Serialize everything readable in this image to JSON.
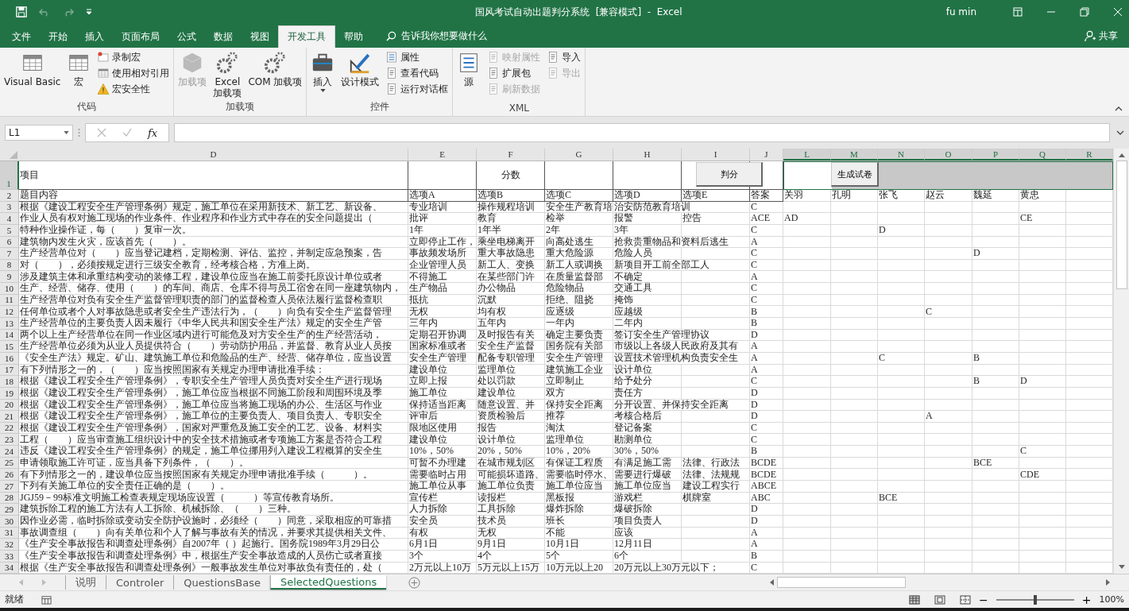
{
  "window": {
    "title": "国风考试自动出题判分系统  [兼容模式]  -  Excel",
    "user": "fu min"
  },
  "ribbon_tabs": [
    {
      "label": "文件",
      "selected": false
    },
    {
      "label": "开始",
      "selected": false
    },
    {
      "label": "插入",
      "selected": false
    },
    {
      "label": "页面布局",
      "selected": false
    },
    {
      "label": "公式",
      "selected": false
    },
    {
      "label": "数据",
      "selected": false
    },
    {
      "label": "视图",
      "selected": false
    },
    {
      "label": "开发工具",
      "selected": true
    },
    {
      "label": "帮助",
      "selected": false
    }
  ],
  "tell_me": {
    "placeholder": "告诉我你想要做什么"
  },
  "share": "共享",
  "ribbon_groups": [
    {
      "label": "代码",
      "items": [
        {
          "kind": "large",
          "label": "Visual Basic",
          "disabled": false
        },
        {
          "kind": "large",
          "label": "宏",
          "disabled": false
        },
        {
          "kind": "small",
          "label": "录制宏",
          "disabled": false
        },
        {
          "kind": "small",
          "label": "使用相对引用",
          "disabled": false
        },
        {
          "kind": "small",
          "label": "宏安全性",
          "disabled": false
        }
      ]
    },
    {
      "label": "加载项",
      "items": [
        {
          "kind": "narrow",
          "label": "加载项",
          "disabled": true
        },
        {
          "kind": "large",
          "label": "Excel\n加载项",
          "disabled": false
        },
        {
          "kind": "large",
          "label": "COM 加载项",
          "disabled": false
        }
      ]
    },
    {
      "label": "控件",
      "items": [
        {
          "kind": "menu",
          "label": "插入",
          "disabled": false
        },
        {
          "kind": "large",
          "label": "设计模式",
          "disabled": false
        },
        {
          "kind": "small",
          "label": "属性",
          "disabled": false
        },
        {
          "kind": "small",
          "label": "查看代码",
          "disabled": false
        },
        {
          "kind": "small",
          "label": "运行对话框",
          "disabled": false
        }
      ]
    },
    {
      "label": "XML",
      "items": [
        {
          "kind": "large",
          "label": "源",
          "disabled": false
        },
        {
          "kind": "small",
          "label": "映射属性",
          "disabled": true
        },
        {
          "kind": "small",
          "label": "扩展包",
          "disabled": false
        },
        {
          "kind": "small",
          "label": "刷新数据",
          "disabled": true
        },
        {
          "kind": "small",
          "label": "导入",
          "disabled": false
        },
        {
          "kind": "small",
          "label": "导出",
          "disabled": true
        }
      ]
    }
  ],
  "formula_bar": {
    "name_box": "L1",
    "function_label": "fx"
  },
  "columns": [
    {
      "letter": "D",
      "selected": false
    },
    {
      "letter": "E",
      "selected": false
    },
    {
      "letter": "F",
      "selected": false
    },
    {
      "letter": "G",
      "selected": false
    },
    {
      "letter": "H",
      "selected": false
    },
    {
      "letter": "I",
      "selected": false
    },
    {
      "letter": "J",
      "selected": false
    },
    {
      "letter": "L",
      "selected": true
    },
    {
      "letter": "M",
      "selected": true
    },
    {
      "letter": "N",
      "selected": true
    },
    {
      "letter": "O",
      "selected": true
    },
    {
      "letter": "P",
      "selected": true
    },
    {
      "letter": "Q",
      "selected": true
    },
    {
      "letter": "R",
      "selected": true
    }
  ],
  "sheet_buttons": [
    {
      "label": "判分"
    },
    {
      "label": "生成试卷"
    }
  ],
  "rows": [
    {
      "number": "1",
      "selected": true,
      "D": "项目",
      "F": "分数"
    },
    {
      "number": "2",
      "selected": false,
      "D": "题目内容",
      "E": "选项A",
      "F": "选项B",
      "G": "选项C",
      "H": "选项D",
      "I": "选项E",
      "J": "答案",
      "L": "关羽",
      "M": "孔明",
      "N": "张飞",
      "O": "赵云",
      "P": "魏延",
      "Q": "黄忠"
    },
    {
      "number": "3",
      "selected": false,
      "D": "根据《建设工程安全生产管理条例》规定，施工单位在采用新技术、新工艺、新设备、",
      "E": "专业培训",
      "F": "操作规程培训",
      "G": "安全生产教育培",
      "H": "治安防范教育培训",
      "J": "C"
    },
    {
      "number": "4",
      "selected": false,
      "D": "作业人员有权对施工现场的作业条件、作业程序和作业方式中存在的安全问题提出（",
      "E": "批评",
      "F": "教育",
      "G": "检举",
      "H": "报警",
      "I": "控告",
      "J": "ACE",
      "L": "AD",
      "Q": "CE"
    },
    {
      "number": "5",
      "selected": false,
      "D": "特种作业操作证，每（　　）复审一次。",
      "E": "1年",
      "F": "1年半",
      "G": "2年",
      "H": "3年",
      "J": "C",
      "N": "D"
    },
    {
      "number": "6",
      "selected": false,
      "D": "建筑物内发生火灾，应该首先（　　）。",
      "E": "立即停止工作，",
      "F": "乘坐电梯离开",
      "G": "向高处逃生",
      "H": "抢救贵重物品和资料后逃生",
      "J": "A"
    },
    {
      "number": "7",
      "selected": false,
      "D": "生产经营单位对（　　）应当登记建档，定期检测、评估、监控，并制定应急预案，告",
      "E": "事故频发场所",
      "F": "重大事故隐患",
      "G": "重大危险源",
      "H": "危险人员",
      "J": "C",
      "P": "D"
    },
    {
      "number": "8",
      "selected": false,
      "D": "对（　　），必须按规定进行三级安全教育，经考核合格，方准上岗。",
      "E": "企业管理人员",
      "F": "新工人、变换",
      "G": "新工人或调换",
      "H": "新项目开工前全部工人",
      "J": "C"
    },
    {
      "number": "9",
      "selected": false,
      "D": "涉及建筑主体和承重结构变动的装修工程，建设单位应当在施工前委托原设计单位或者",
      "E": "不得施工",
      "F": "在某些部门许",
      "G": "在质量监督部",
      "H": "不确定",
      "J": "A"
    },
    {
      "number": "10",
      "selected": false,
      "D": "生产、经营、储存、使用（　　）的车间、商店、仓库不得与员工宿舍在同一座建筑物内，",
      "E": "生产物品",
      "F": "办公物品",
      "G": "危险物品",
      "H": "交通工具",
      "J": "C"
    },
    {
      "number": "11",
      "selected": false,
      "D": "生产经营单位对负有安全生产监督管理职责的部门的监督检查人员依法履行监督检查职",
      "E": "抵抗",
      "F": "沉默",
      "G": "拒绝、阻挠",
      "H": "掩饰",
      "J": "C"
    },
    {
      "number": "12",
      "selected": false,
      "D": "任何单位或者个人对事故隐患或者安全生产违法行为，（　　）向负有安全生产监督管理",
      "E": "无权",
      "F": "均有权",
      "G": "应逐级",
      "H": "应越级",
      "J": "B",
      "O": "C"
    },
    {
      "number": "13",
      "selected": false,
      "D": "生产经营单位的主要负责人因未履行《中华人民共和国安全生产法》规定的安全生产管",
      "E": "三年内",
      "F": "五年内",
      "G": "一年内",
      "H": "二年内",
      "J": "B"
    },
    {
      "number": "14",
      "selected": false,
      "D": "两个以上生产经营单位在同一作业区域内进行可能危及对方安全生产的生产经营活动，",
      "E": "定期召开协调",
      "F": "及时报告有关",
      "G": "确定主要负责",
      "H": "签订安全生产管理协议",
      "J": "D"
    },
    {
      "number": "15",
      "selected": false,
      "D": "生产经营单位必须为从业人员提供符合（　　）劳动防护用品，并监督、教育从业人员按",
      "E": "国家标准或者",
      "F": "安全生产监督",
      "G": "国务院有关部",
      "H": "市级以上各级人民政府及其有",
      "J": "A"
    },
    {
      "number": "16",
      "selected": false,
      "D": "《安全生产法》规定。矿山、建筑施工单位和危险品的生产、经营、储存单位，应当设置",
      "E": "安全生产管理",
      "F": "配备专职管理",
      "G": "安全生产管理",
      "H": "设置技术管理机构负责安全生",
      "J": "A",
      "N": "C",
      "P": "B"
    },
    {
      "number": "17",
      "selected": false,
      "D": "有下列情形之一的，（　　）应当按照国家有关规定办理申请批准手续：",
      "E": "建设单位",
      "F": "监理单位",
      "G": "建筑施工企业",
      "H": "设计单位",
      "J": "A"
    },
    {
      "number": "18",
      "selected": false,
      "D": "根据《建设工程安全生产管理条例》，专职安全生产管理人员负责对安全生产进行现场",
      "E": "立即上报",
      "F": "处以罚款",
      "G": "立即制止",
      "H": "给予处分",
      "J": "C",
      "P": "B",
      "Q": "D"
    },
    {
      "number": "19",
      "selected": false,
      "D": "根据《建设工程安全生产管理条例》，施工单位应当根据不同施工阶段和周围环境及季",
      "E": "施工单位",
      "F": "建设单位",
      "G": "双方",
      "H": "责任方",
      "J": "D"
    },
    {
      "number": "20",
      "selected": false,
      "D": "根据《建设工程安全生产管理条例》，施工单位应当将施工现场的办公、生活区与作业",
      "E": "保持适当距离",
      "F": "随意设置、并",
      "G": "保持安全距离",
      "H": "分开设置、并保持安全距离",
      "J": "D"
    },
    {
      "number": "21",
      "selected": false,
      "D": "根据《建设工程安全生产管理条例》，施工单位的主要负责人、项目负责人、专职安全",
      "E": "评审后",
      "F": "资质检验后",
      "G": "推荐",
      "H": "考核合格后",
      "J": "D",
      "O": "A"
    },
    {
      "number": "22",
      "selected": false,
      "D": "根据《建设工程安全生产管理条例》，国家对严重危及施工安全的工艺、设备、材料实",
      "E": "限地区使用",
      "F": "报告",
      "G": "淘汰",
      "H": "登记备案",
      "J": "C"
    },
    {
      "number": "23",
      "selected": false,
      "D": "工程（　　）应当审查施工组织设计中的安全技术措施或者专项施工方案是否符合工程",
      "E": "建设单位",
      "F": "设计单位",
      "G": "监理单位",
      "H": "勘测单位",
      "J": "C"
    },
    {
      "number": "24",
      "selected": false,
      "D": "违反《建设工程安全生产管理条例》的规定，施工单位挪用列入建设工程概算的安全生",
      "E": "10%，50%",
      "F": "20%，50%",
      "G": "10%，20%",
      "H": "30%，50%",
      "J": "B",
      "Q": "C"
    },
    {
      "number": "25",
      "selected": false,
      "D": "申请领取施工许可证，应当具备下列条件，（　　）。",
      "E": "可暂不办理建",
      "F": "在城市规划区",
      "G": "有保证工程质",
      "H": "有满足施工需",
      "I": "法律、行政法",
      "J": "BCDE",
      "P": "BCE"
    },
    {
      "number": "26",
      "selected": false,
      "D": "有下列情形之一的，建设单位应当按照国家有关规定办理申请批准手续（　　　）。",
      "E": "需要临时占用",
      "F": "可能损坏道路、",
      "G": "需要临时停水、",
      "H": "需要进行爆破",
      "I": "法律、法规规",
      "J": "BCDE",
      "Q": "CDE"
    },
    {
      "number": "27",
      "selected": false,
      "D": "下列有关施工单位的安全责任正确的是（　　）。",
      "E": "施工单位从事",
      "F": "施工单位负责",
      "G": "施工单位应当",
      "H": "施工单位应当",
      "I": "建设工程实行",
      "J": "ABCE"
    },
    {
      "number": "28",
      "selected": false,
      "D": "JGJ59－99标准文明施工检查表规定现场应设置（　　　）等宣传教育场所。",
      "E": "宣传栏",
      "F": "读报栏",
      "G": "黑板报",
      "H": "游戏栏",
      "I": "棋牌室",
      "J": "ABC",
      "N": "BCE"
    },
    {
      "number": "29",
      "selected": false,
      "D": "建筑拆除工程的施工方法有人工拆除、机械拆除、（　　）三种。",
      "E": "人力拆除",
      "F": "工具拆除",
      "G": "爆炸拆除",
      "H": "爆破拆除",
      "J": "D"
    },
    {
      "number": "30",
      "selected": false,
      "D": "因作业必需，临时拆除或变动安全防护设施时，必须经（　　）同意，采取相应的可靠措",
      "E": "安全员",
      "F": "技术员",
      "G": "班长",
      "H": "项目负责人",
      "J": "D"
    },
    {
      "number": "31",
      "selected": false,
      "D": "事故调查组（　　）向有关单位和个人了解与事故有关的情况，并要求其提供相关文件、",
      "E": "有权",
      "F": "无权",
      "G": "不能",
      "H": "应该",
      "J": "A"
    },
    {
      "number": "32",
      "selected": false,
      "D": "《生产安全事故报告和调查处理条例》自2007年（ ）起施行。国务院1989年3月29日公",
      "E": "6月1日",
      "F": "9月1日",
      "G": "10月1日",
      "H": "12月11日",
      "J": "A"
    },
    {
      "number": "33",
      "selected": false,
      "D": "《生产安全事故报告和调查处理条例》中，根据生产安全事故造成的人员伤亡或者直接",
      "E": "3个",
      "F": "4个",
      "G": "5个",
      "H": "6个",
      "J": "B"
    },
    {
      "number": "34",
      "selected": false,
      "D": "根据《生产安全事故报告和调查处理条例》一般事故发生单位对事故负有责任的，处（",
      "E": "2万元以上10万",
      "F": "5万元以上15万",
      "G": "10万元以上20",
      "H": "20万元以上30万元以下；",
      "J": "C"
    }
  ],
  "sheet_tabs": [
    {
      "label": "说明",
      "selected": false
    },
    {
      "label": "Controler",
      "selected": false
    },
    {
      "label": "QuestionsBase",
      "selected": false
    },
    {
      "label": "SelectedQuestions",
      "selected": true
    }
  ],
  "status_bar": {
    "text": "就绪",
    "zoom_out": "−",
    "zoom_in": "+",
    "zoom": "100%",
    "zoom_slider": {
      "level": 0.5
    }
  }
}
